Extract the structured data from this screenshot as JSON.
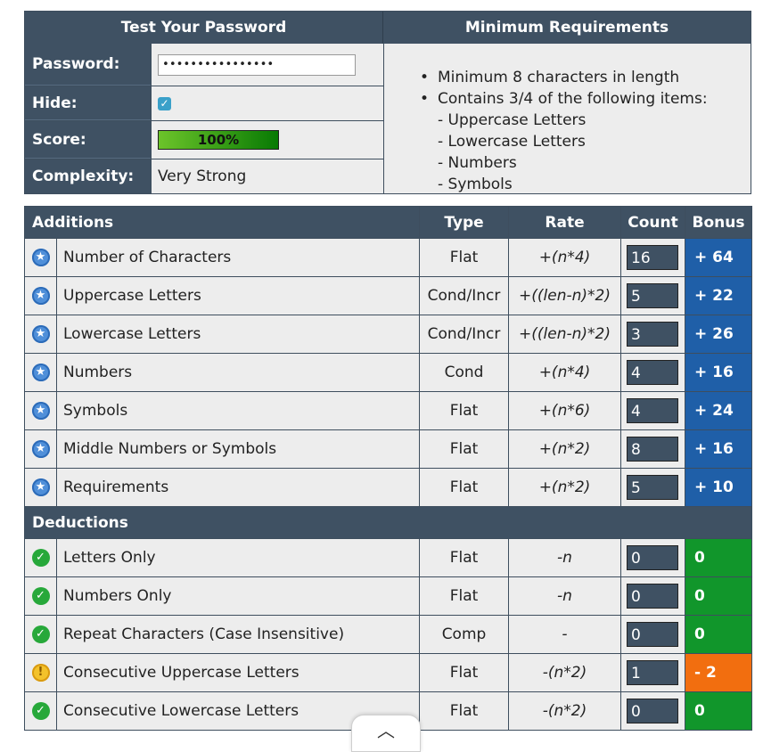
{
  "top_panel": {
    "test_header": "Test Your Password",
    "req_header": "Minimum Requirements",
    "password_label": "Password:",
    "password_value": "••••••••••••••••",
    "hide_label": "Hide:",
    "hide_checked": true,
    "score_label": "Score:",
    "score_value": "100%",
    "complexity_label": "Complexity:",
    "complexity_value": "Very Strong"
  },
  "requirements": {
    "bullets": [
      "Minimum 8 characters in length",
      "Contains 3/4 of the following items:"
    ],
    "sub_items": [
      "- Uppercase Letters",
      "- Lowercase Letters",
      "- Numbers",
      "- Symbols"
    ]
  },
  "table": {
    "headers": {
      "section": "Additions",
      "type": "Type",
      "rate": "Rate",
      "count": "Count",
      "bonus": "Bonus"
    },
    "additions": [
      {
        "name": "Number of Characters",
        "type": "Flat",
        "rate": "+(n*4)",
        "count": "16",
        "bonus": "+ 64"
      },
      {
        "name": "Uppercase Letters",
        "type": "Cond/Incr",
        "rate": "+((len-n)*2)",
        "count": "5",
        "bonus": "+ 22"
      },
      {
        "name": "Lowercase Letters",
        "type": "Cond/Incr",
        "rate": "+((len-n)*2)",
        "count": "3",
        "bonus": "+ 26"
      },
      {
        "name": "Numbers",
        "type": "Cond",
        "rate": "+(n*4)",
        "count": "4",
        "bonus": "+ 16"
      },
      {
        "name": "Symbols",
        "type": "Flat",
        "rate": "+(n*6)",
        "count": "4",
        "bonus": "+ 24"
      },
      {
        "name": "Middle Numbers or Symbols",
        "type": "Flat",
        "rate": "+(n*2)",
        "count": "8",
        "bonus": "+ 16"
      },
      {
        "name": "Requirements",
        "type": "Flat",
        "rate": "+(n*2)",
        "count": "5",
        "bonus": "+ 10"
      }
    ],
    "deductions_header": "Deductions",
    "deductions": [
      {
        "name": "Letters Only",
        "type": "Flat",
        "rate": "-n",
        "count": "0",
        "bonus": "0"
      },
      {
        "name": "Numbers Only",
        "type": "Flat",
        "rate": "-n",
        "count": "0",
        "bonus": "0"
      },
      {
        "name": "Repeat Characters (Case Insensitive)",
        "type": "Comp",
        "rate": "-",
        "count": "0",
        "bonus": "0"
      },
      {
        "name": "Consecutive Uppercase Letters",
        "type": "Flat",
        "rate": "-(n*2)",
        "count": "1",
        "bonus": "- 2"
      },
      {
        "name": "Consecutive Lowercase Letters",
        "type": "Flat",
        "rate": "-(n*2)",
        "count": "0",
        "bonus": "0"
      }
    ]
  },
  "icons": {
    "addition": "star-circle-icon",
    "pass": "check-circle-icon",
    "warning": "exclamation-circle-icon",
    "scroll": "chevron-up-icon"
  },
  "colors": {
    "header_bg": "#3f5163",
    "bonus_blue": "#1f5fa8",
    "bonus_green": "#11962b",
    "bonus_orange": "#f26e0f"
  }
}
